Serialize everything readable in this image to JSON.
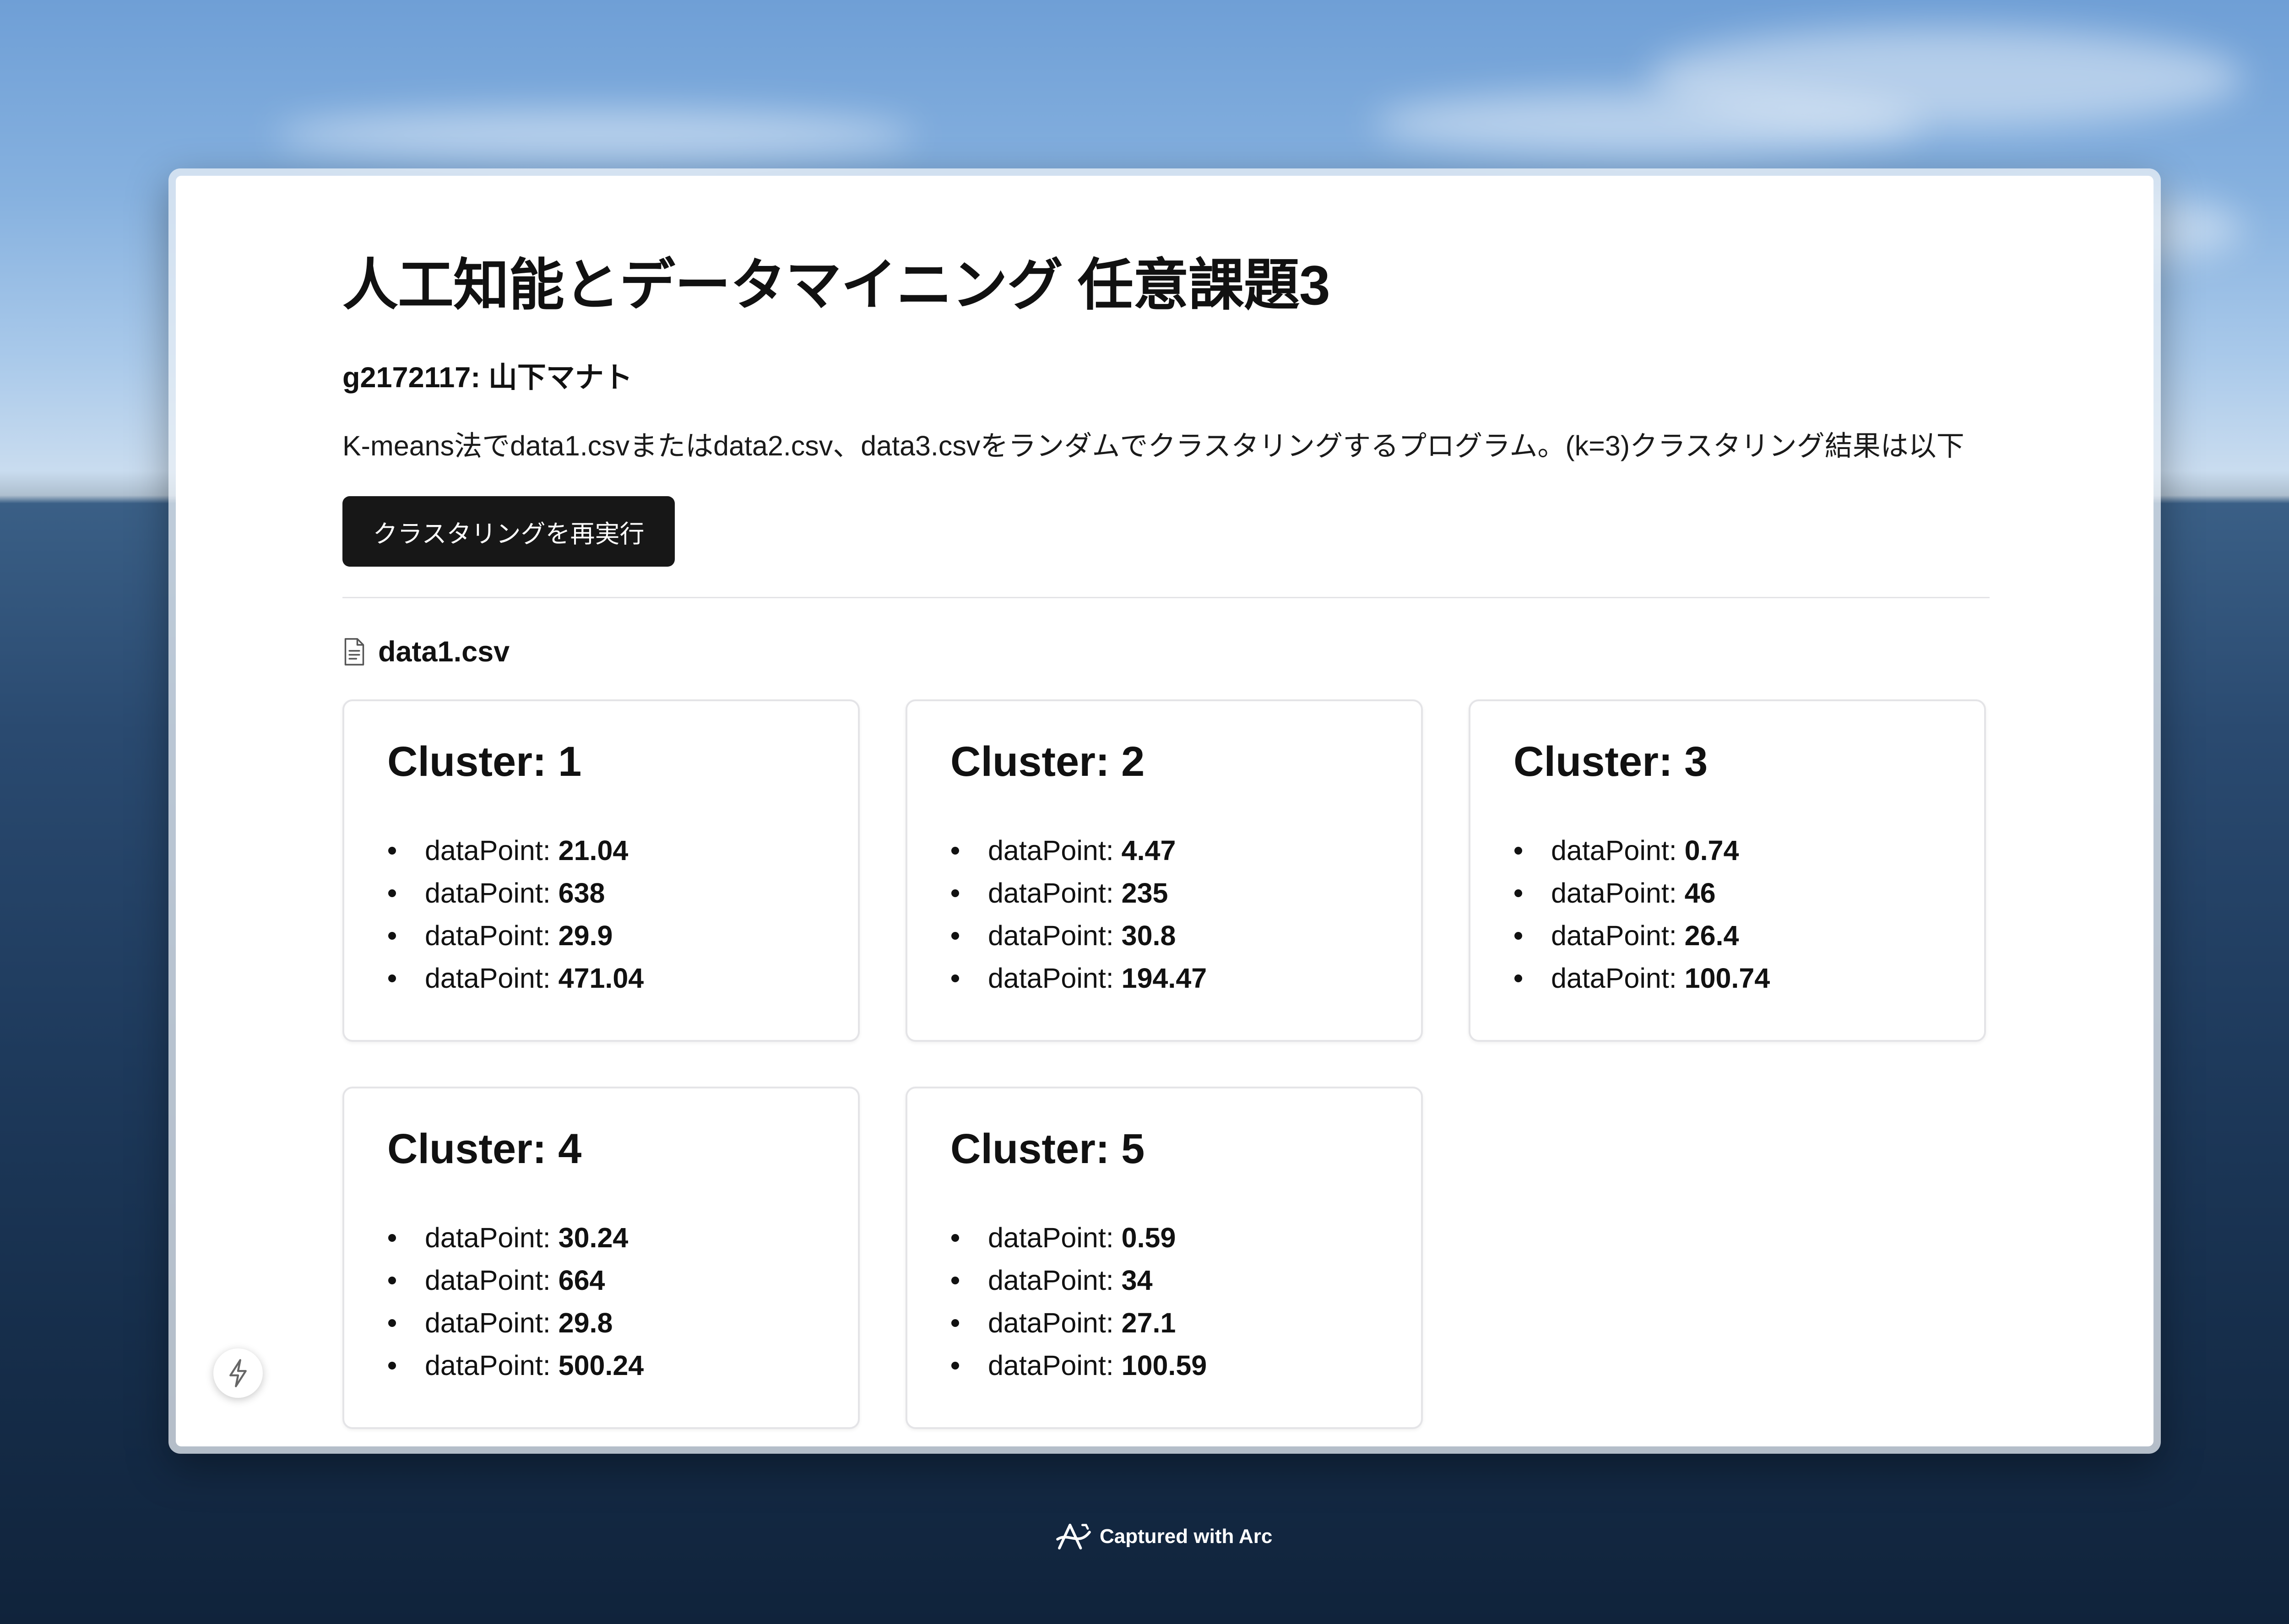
{
  "page": {
    "title": "人工知能とデータマイニング 任意課題3",
    "student": "g2172117: 山下マナト",
    "description": "K-means法でdata1.csvまたはdata2.csv、data3.csvをランダムでクラスタリングするプログラム。(k=3)クラスタリング結果は以下",
    "rerun_button": "クラスタリングを再実行",
    "file_icon": "file-text-icon",
    "file_name": "data1.csv"
  },
  "point_label": "dataPoint: ",
  "clusters": [
    {
      "title": "Cluster: 1",
      "points": [
        "21.04",
        "638",
        "29.9",
        "471.04"
      ]
    },
    {
      "title": "Cluster: 2",
      "points": [
        "4.47",
        "235",
        "30.8",
        "194.47"
      ]
    },
    {
      "title": "Cluster: 3",
      "points": [
        "0.74",
        "46",
        "26.4",
        "100.74"
      ]
    },
    {
      "title": "Cluster: 4",
      "points": [
        "30.24",
        "664",
        "29.8",
        "500.24"
      ]
    },
    {
      "title": "Cluster: 5",
      "points": [
        "0.59",
        "34",
        "27.1",
        "100.59"
      ]
    }
  ],
  "floating_button_icon": "lightning-bolt-icon",
  "footer": {
    "logo_icon": "arc-logo-icon",
    "caption": "Captured with Arc"
  },
  "colors": {
    "button_bg": "#171717",
    "text": "#111111",
    "card_border": "#e4e4e7"
  }
}
